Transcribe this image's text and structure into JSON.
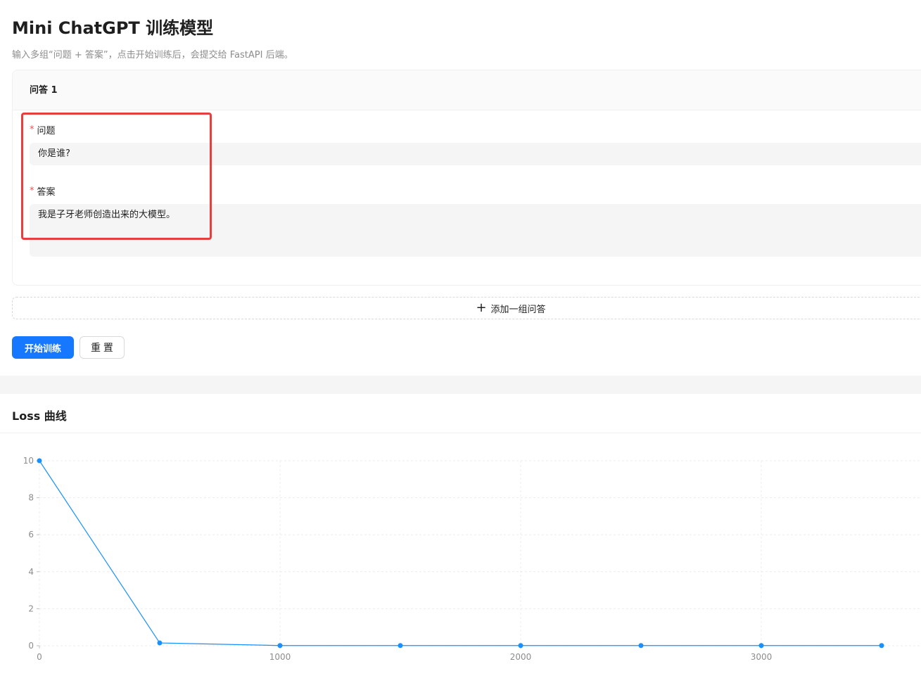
{
  "header": {
    "title": "Mini ChatGPT 训练模型",
    "subtitle": "输入多组“问题 + 答案”，点击开始训练后，会提交给 FastAPI 后端。"
  },
  "qa_card": {
    "title": "问答 1",
    "question_label": "问题",
    "question_value": "你是谁?",
    "answer_label": "答案",
    "answer_value": "我是子牙老师创造出来的大模型。",
    "required_mark": "*"
  },
  "actions": {
    "add_label": "添加一组问答",
    "add_icon": "plus-icon",
    "start_label": "开始训练",
    "reset_label": "重 置"
  },
  "chart_section": {
    "title": "Loss 曲线"
  },
  "colors": {
    "primary": "#1677ff",
    "required": "#ff4d4f",
    "highlight": "#e5403f",
    "line": "#1890ff"
  },
  "chart_data": {
    "type": "line",
    "title": "",
    "xlabel": "",
    "ylabel": "",
    "x": [
      0,
      500,
      1000,
      1500,
      2000,
      2500,
      3000,
      3500
    ],
    "series": [
      {
        "values": [
          10,
          0.15,
          0.01,
          0.01,
          0.01,
          0.01,
          0.01,
          0.01
        ]
      }
    ],
    "xticks": [
      0,
      1000,
      2000,
      3000
    ],
    "yticks": [
      0,
      2,
      4,
      6,
      8,
      10
    ],
    "xlim": [
      0,
      3700
    ],
    "ylim": [
      0,
      10
    ],
    "grid": true,
    "legend": "none"
  }
}
